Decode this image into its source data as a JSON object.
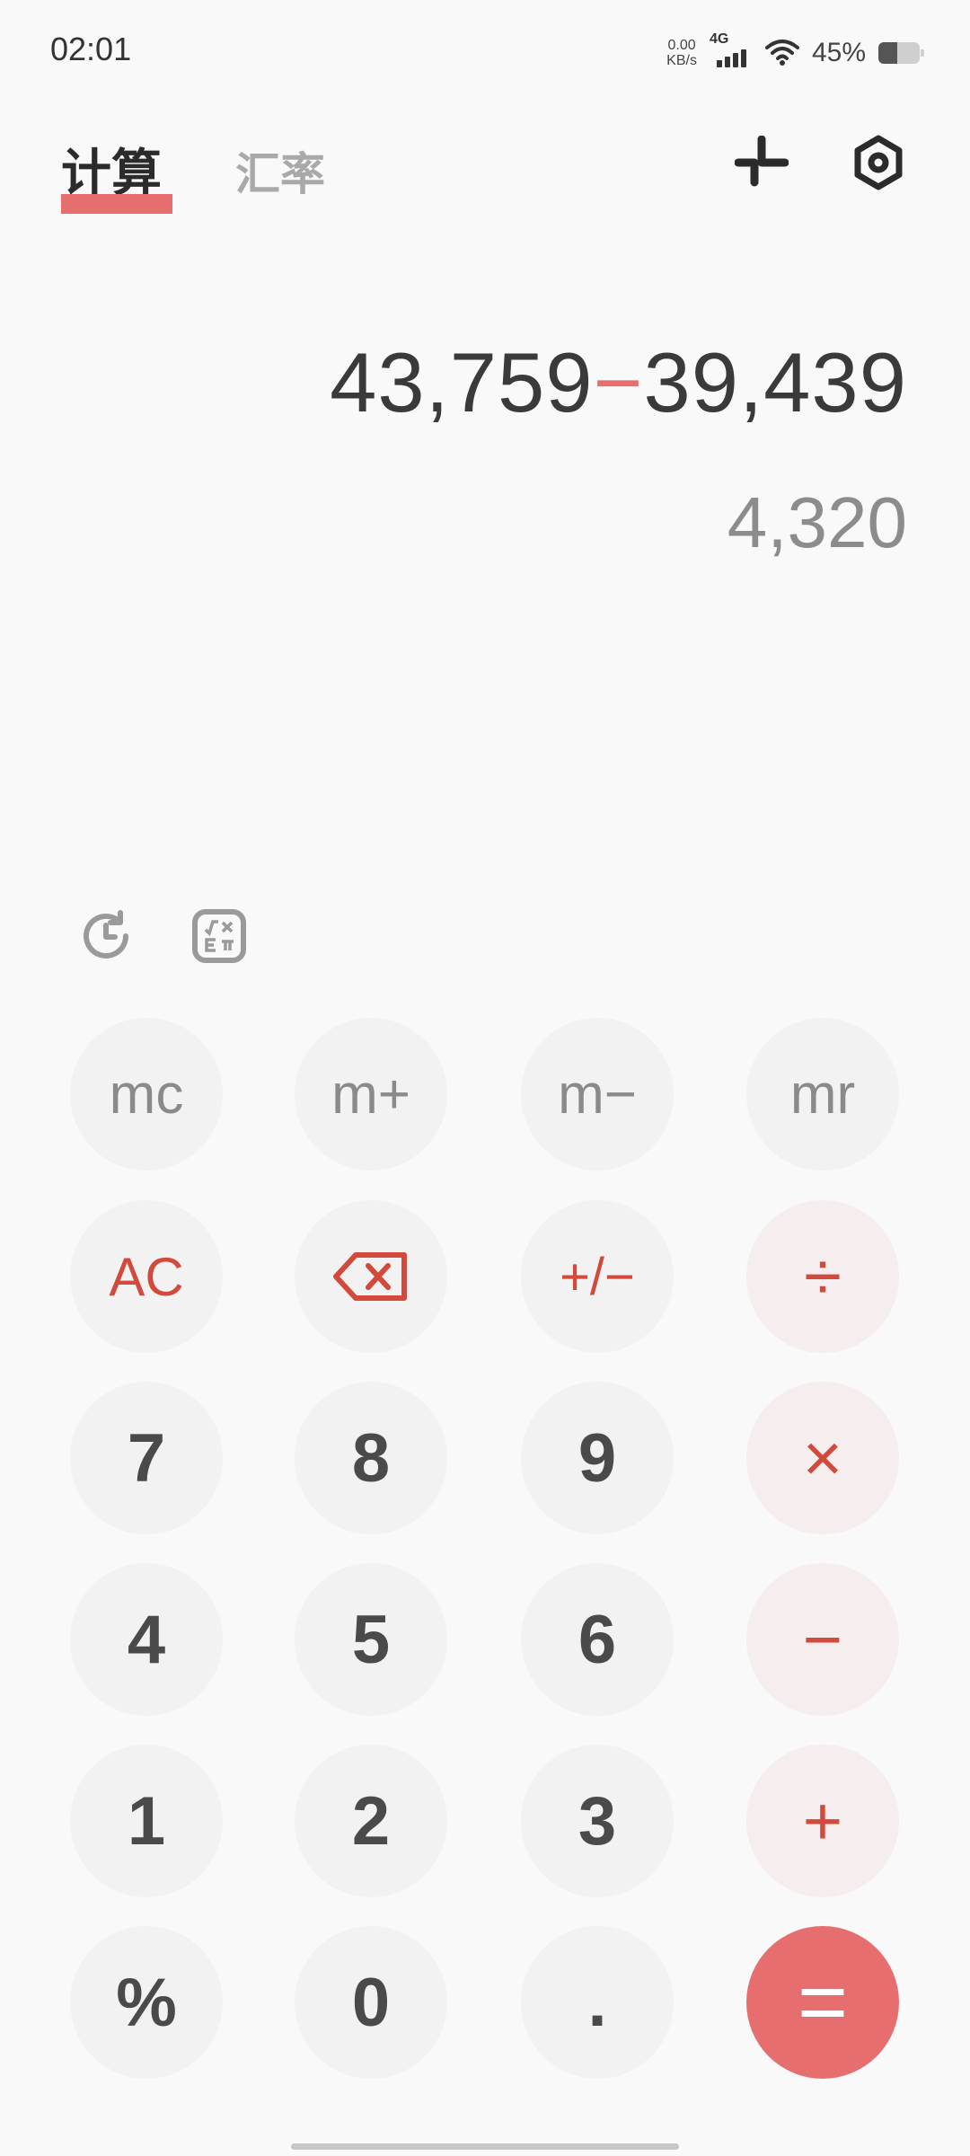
{
  "status": {
    "time": "02:01",
    "net_speed_value": "0.00",
    "net_speed_unit": "KB/s",
    "network": "4G",
    "battery_percent": "45%",
    "battery_level": 0.45
  },
  "tabs": [
    {
      "label": "计算",
      "active": true
    },
    {
      "label": "汇率",
      "active": false
    }
  ],
  "header_icons": [
    "collapse-icon",
    "settings-icon"
  ],
  "display": {
    "operand1": "43,759",
    "operator": "−",
    "operand2": "39,439",
    "result": "4,320"
  },
  "tools": [
    "history-icon",
    "scientific-icon"
  ],
  "keys": {
    "mc": "mc",
    "mplus": "m+",
    "mminus": "m−",
    "mr": "mr",
    "ac": "AC",
    "sign": "+/−",
    "divide": "÷",
    "seven": "7",
    "eight": "8",
    "nine": "9",
    "multiply": "×",
    "four": "4",
    "five": "5",
    "six": "6",
    "minus": "−",
    "one": "1",
    "two": "2",
    "three": "3",
    "plus": "+",
    "percent": "%",
    "zero": "0",
    "dot": ".",
    "equals": "="
  },
  "colors": {
    "accent": "#e66e6e",
    "operator_text": "#d24a3c",
    "key_bg": "#f2f2f2",
    "operator_key_bg": "#f6eeee"
  }
}
